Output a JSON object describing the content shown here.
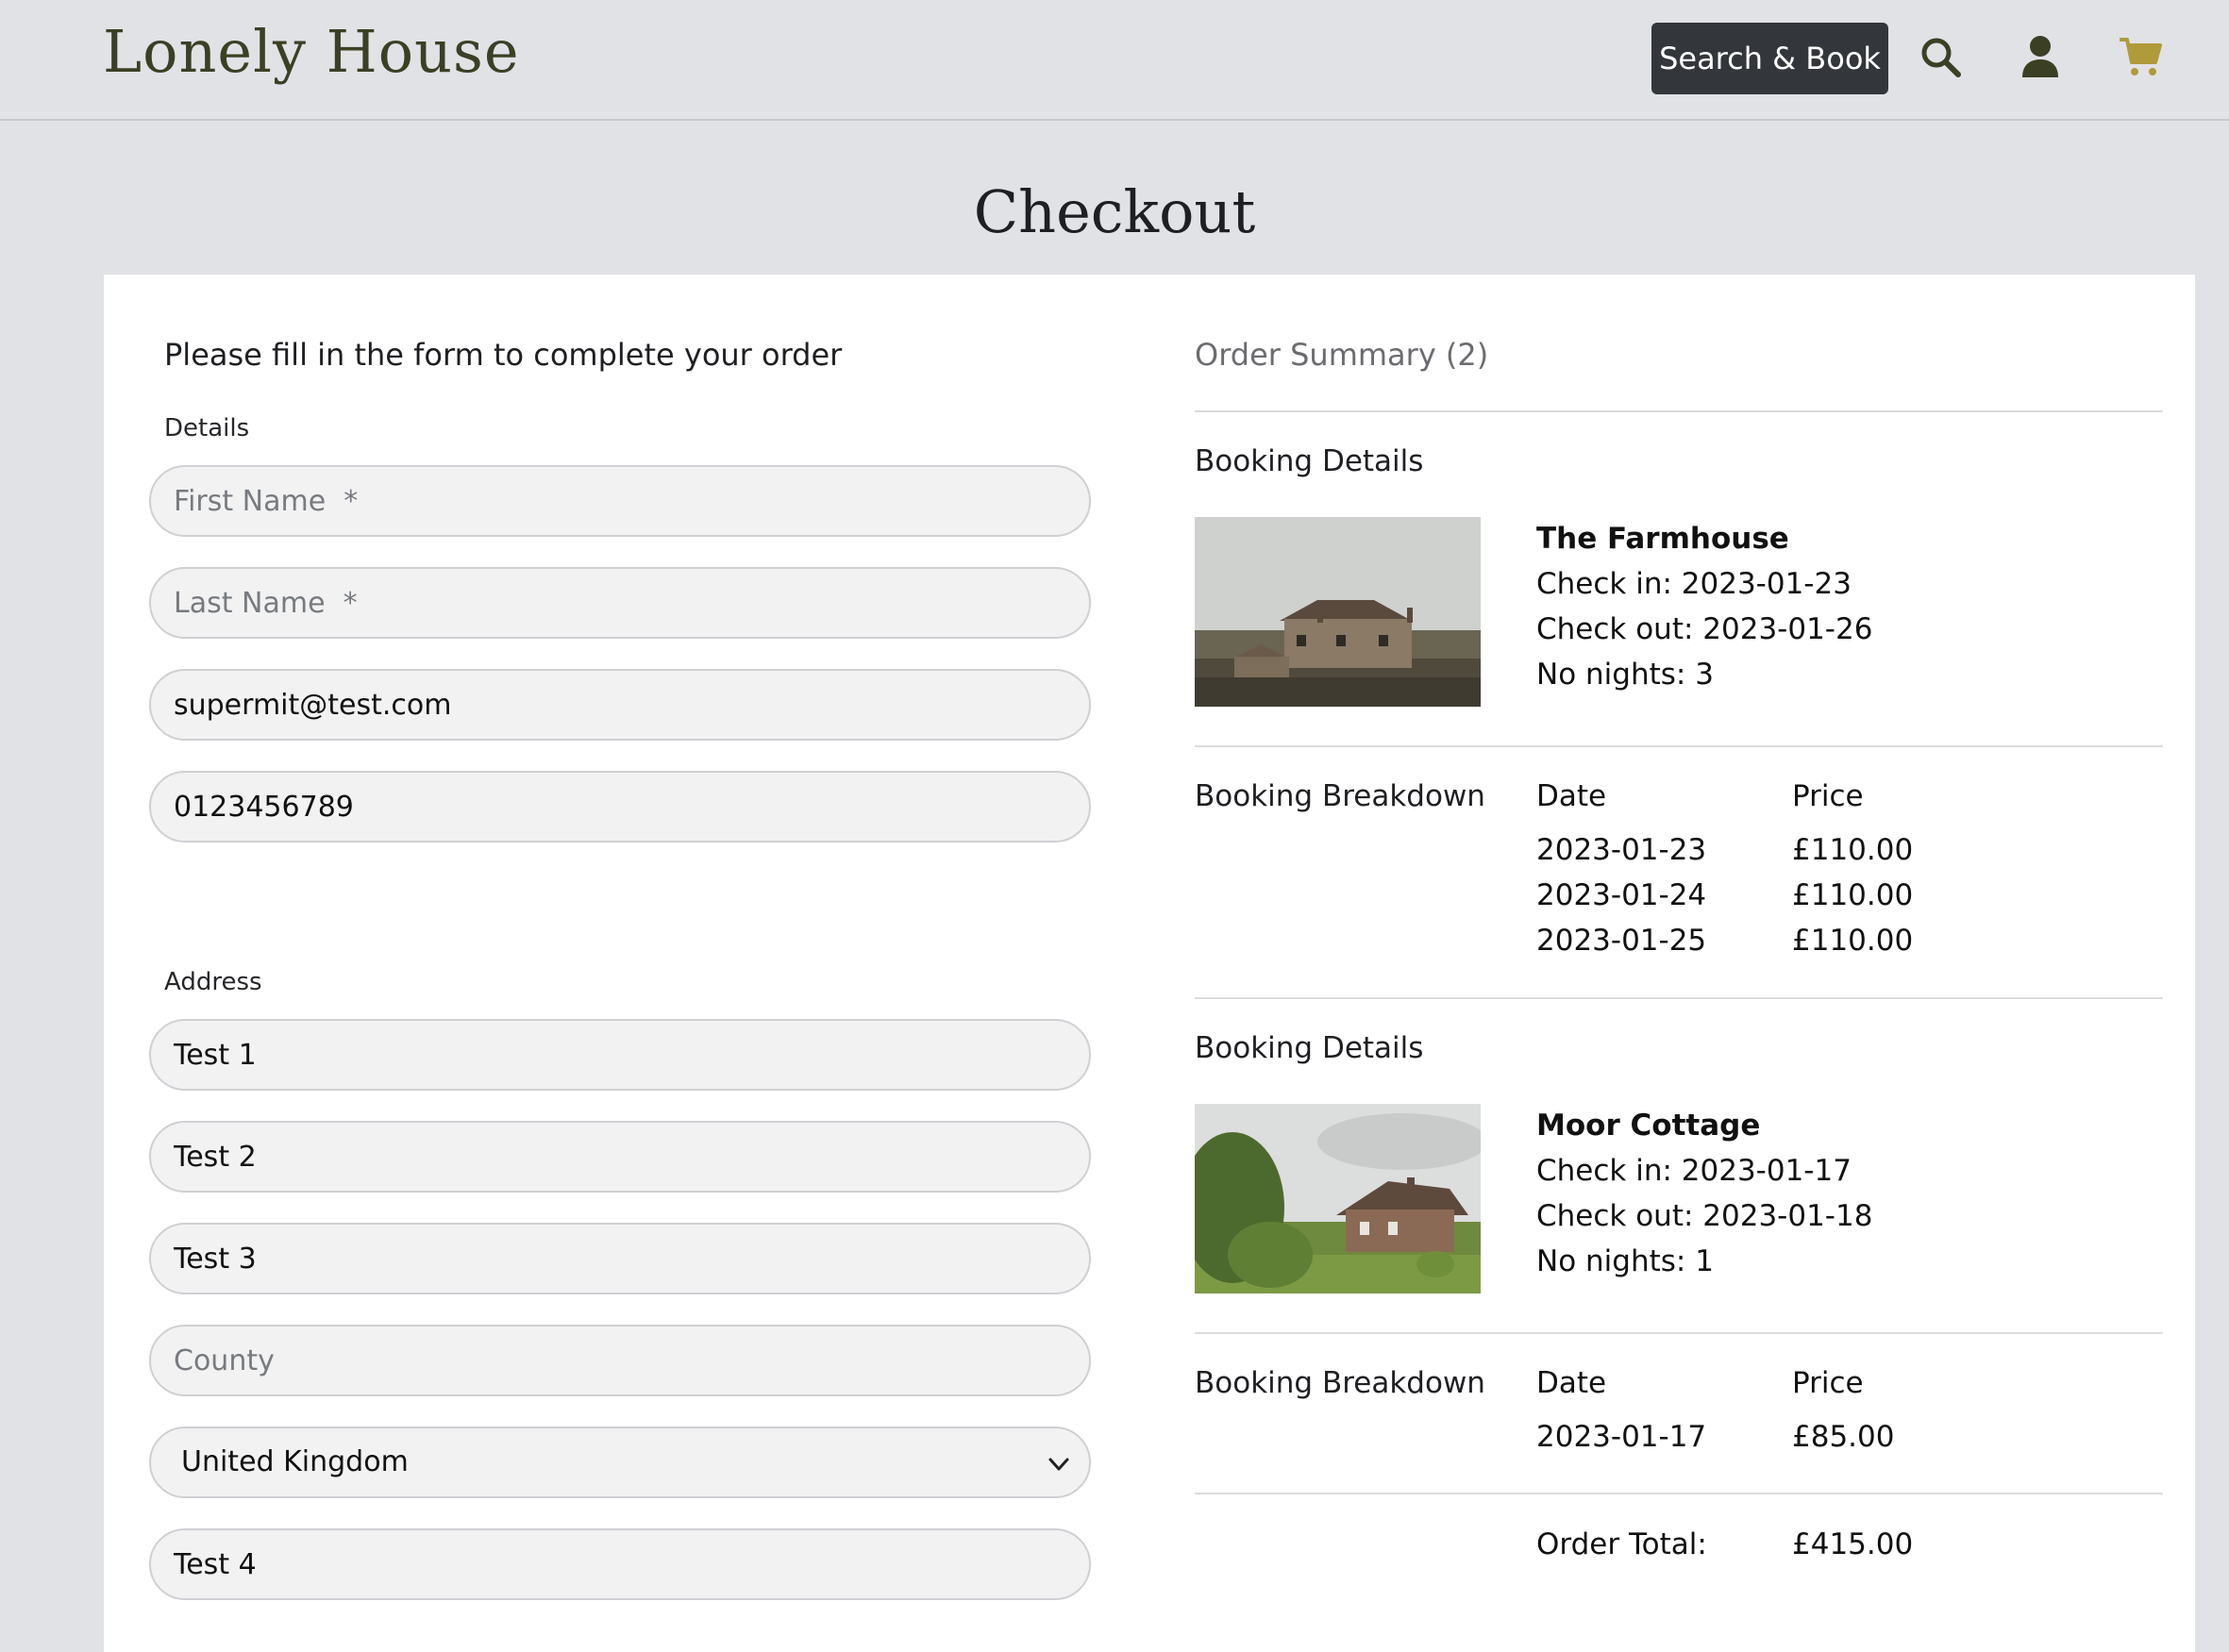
{
  "header": {
    "brand": "Lonely House",
    "search_book_label": "Search & Book",
    "icons": [
      "search-icon",
      "user-icon",
      "cart-icon"
    ],
    "accent_color": "#b09a3a",
    "brand_color": "#3b4024"
  },
  "page_title": "Checkout",
  "form": {
    "intro": "Please fill in the form to complete your order",
    "details_label": "Details",
    "first_name": {
      "value": "",
      "placeholder": "First Name  *"
    },
    "last_name": {
      "value": "",
      "placeholder": "Last Name  *"
    },
    "email": {
      "value": "supermit@test.com",
      "placeholder": ""
    },
    "phone": {
      "value": "0123456789",
      "placeholder": ""
    },
    "address_label": "Address",
    "address1": {
      "value": "Test 1",
      "placeholder": ""
    },
    "address2": {
      "value": "Test 2",
      "placeholder": ""
    },
    "address3": {
      "value": "Test 3",
      "placeholder": ""
    },
    "county": {
      "value": "",
      "placeholder": "County"
    },
    "country": {
      "selected": "United Kingdom"
    },
    "postcode": {
      "value": "Test 4",
      "placeholder": ""
    }
  },
  "summary": {
    "title": "Order Summary (2)",
    "bookings": [
      {
        "details_label": "Booking Details",
        "name": "The Farmhouse",
        "check_in": "Check in: 2023-01-23",
        "check_out": "Check out: 2023-01-26",
        "nights": "No nights: 3",
        "breakdown_label": "Booking Breakdown",
        "date_header": "Date",
        "price_header": "Price",
        "rows": [
          {
            "date": "2023-01-23",
            "price": "£110.00"
          },
          {
            "date": "2023-01-24",
            "price": "£110.00"
          },
          {
            "date": "2023-01-25",
            "price": "£110.00"
          }
        ]
      },
      {
        "details_label": "Booking Details",
        "name": "Moor Cottage",
        "check_in": "Check in: 2023-01-17",
        "check_out": "Check out: 2023-01-18",
        "nights": "No nights: 1",
        "breakdown_label": "Booking Breakdown",
        "date_header": "Date",
        "price_header": "Price",
        "rows": [
          {
            "date": "2023-01-17",
            "price": "£85.00"
          }
        ]
      }
    ],
    "total_label": "Order Total:",
    "total_value": "£415.00"
  }
}
